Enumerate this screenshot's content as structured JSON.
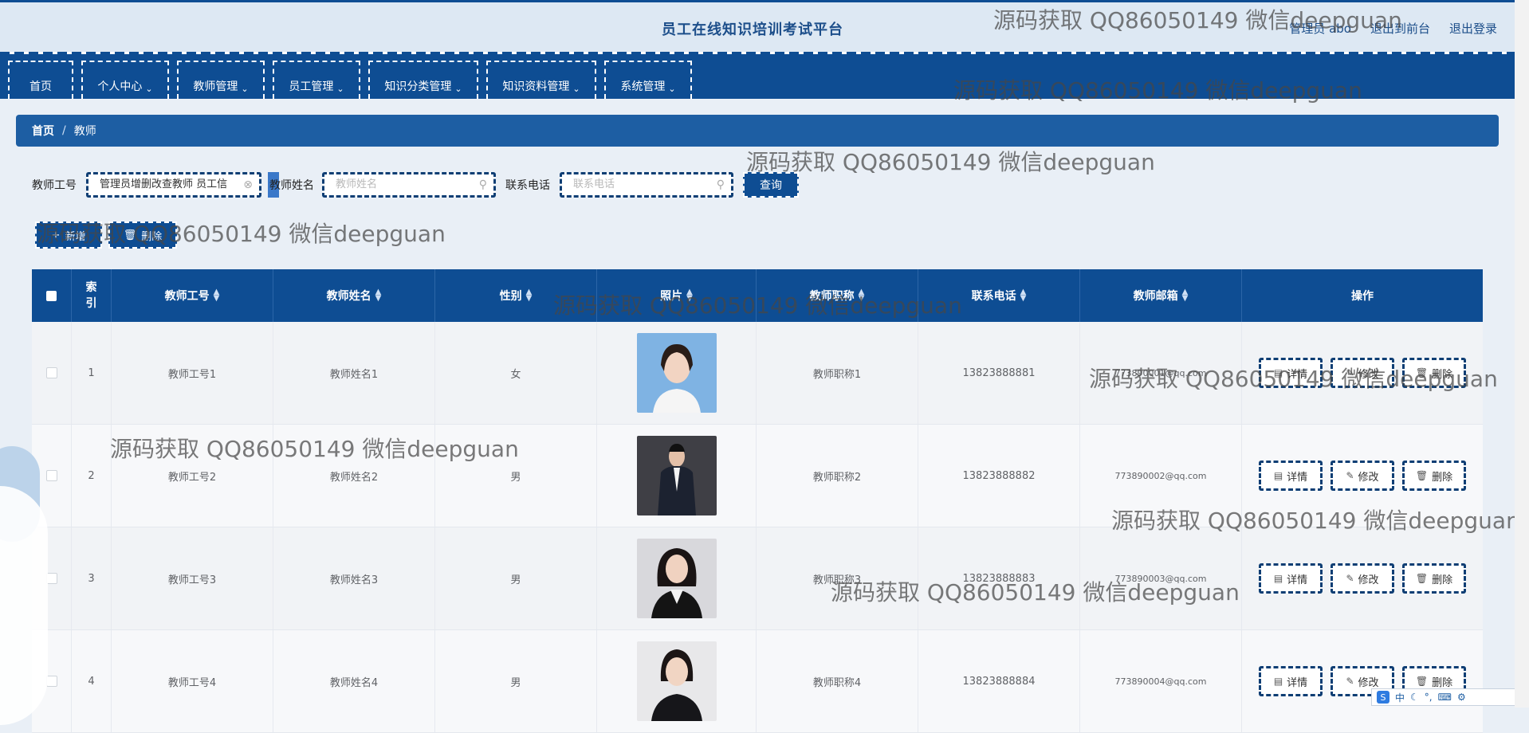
{
  "header": {
    "title": "员工在线知识培训考试平台",
    "links": [
      "管理员 abo",
      "退出到前台",
      "退出登录"
    ]
  },
  "nav": {
    "items": [
      {
        "label": "首页",
        "dropdown": false
      },
      {
        "label": "个人中心",
        "dropdown": true
      },
      {
        "label": "教师管理",
        "dropdown": true
      },
      {
        "label": "员工管理",
        "dropdown": true
      },
      {
        "label": "知识分类管理",
        "dropdown": true
      },
      {
        "label": "知识资料管理",
        "dropdown": true
      },
      {
        "label": "系统管理",
        "dropdown": true
      }
    ]
  },
  "breadcrumb": {
    "home": "首页",
    "separator": "/",
    "current": "教师"
  },
  "search": {
    "teacher_no_label": "教师工号",
    "teacher_no_value": "管理员增删改查教师 员工信",
    "teacher_name_label": "教师姓名",
    "teacher_name_placeholder": "教师姓名",
    "phone_label": "联系电话",
    "phone_placeholder": "联系电话",
    "query_label": "查询"
  },
  "actions": {
    "add_label": "新增",
    "delete_label": "删除"
  },
  "table": {
    "headers": [
      "索引",
      "教师工号",
      "教师姓名",
      "性别",
      "照片",
      "教师职称",
      "联系电话",
      "教师邮箱",
      "操作"
    ],
    "rows": [
      {
        "index": "1",
        "no": "教师工号1",
        "name": "教师姓名1",
        "gender": "女",
        "title": "教师职称1",
        "phone": "13823888881",
        "email": "773890001@qq.com"
      },
      {
        "index": "2",
        "no": "教师工号2",
        "name": "教师姓名2",
        "gender": "男",
        "title": "教师职称2",
        "phone": "13823888882",
        "email": "773890002@qq.com"
      },
      {
        "index": "3",
        "no": "教师工号3",
        "name": "教师姓名3",
        "gender": "男",
        "title": "教师职称3",
        "phone": "13823888883",
        "email": "773890003@qq.com"
      },
      {
        "index": "4",
        "no": "教师工号4",
        "name": "教师姓名4",
        "gender": "男",
        "title": "教师职称4",
        "phone": "13823888884",
        "email": "773890004@qq.com"
      }
    ],
    "row_actions": {
      "detail": "详情",
      "edit": "修改",
      "delete": "删除"
    }
  },
  "watermark": "源码获取 QQ86050149 微信deepguan",
  "ime": {
    "mode": "中"
  },
  "colors": {
    "primary": "#0e4d93",
    "background": "#e9eff6"
  }
}
